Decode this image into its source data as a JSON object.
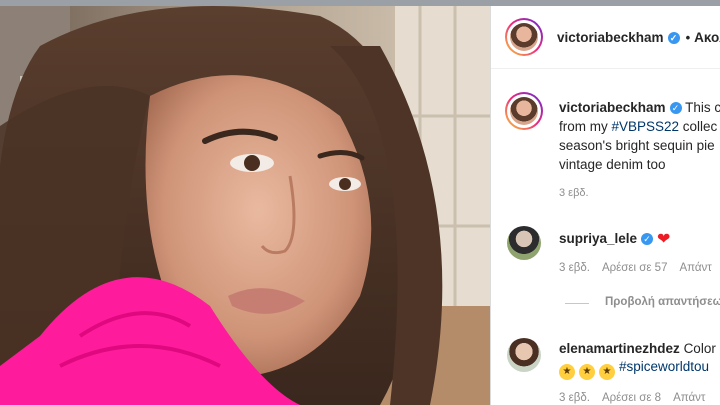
{
  "post": {
    "author": "victoriabeckham",
    "header_separator": "•",
    "follow_label": "Ακολ",
    "caption": {
      "username": "victoriabeckham",
      "text_line1": "This c",
      "text_line2_prefix": "from my ",
      "hashtag": "#VBPSS22",
      "text_line2_suffix": " collec",
      "text_line3": "season's bright sequin pie",
      "text_line4": "vintage denim too"
    },
    "caption_time": "3 εβδ."
  },
  "comments": [
    {
      "username": "supriya_lele",
      "text": "",
      "time": "3 εβδ.",
      "likes": "Αρέσει σε 57",
      "reply_label": "Απάντ",
      "view_replies": "Προβολή απαντήσεω"
    },
    {
      "username": "elenamartinezhdez",
      "text": "Color",
      "hashtag": "#spiceworldtou",
      "time": "3 εβδ.",
      "likes": "Αρέσει σε 8",
      "reply_label": "Απάντ"
    }
  ],
  "icons": {
    "verified": "verified-badge-icon",
    "heart": "red-heart-icon",
    "emoji": "star-struck-emoji-icon"
  },
  "colors": {
    "link": "#00376b",
    "verified": "#3897f0",
    "heart": "#ed1c24",
    "sweater": "#ff1c9c"
  }
}
